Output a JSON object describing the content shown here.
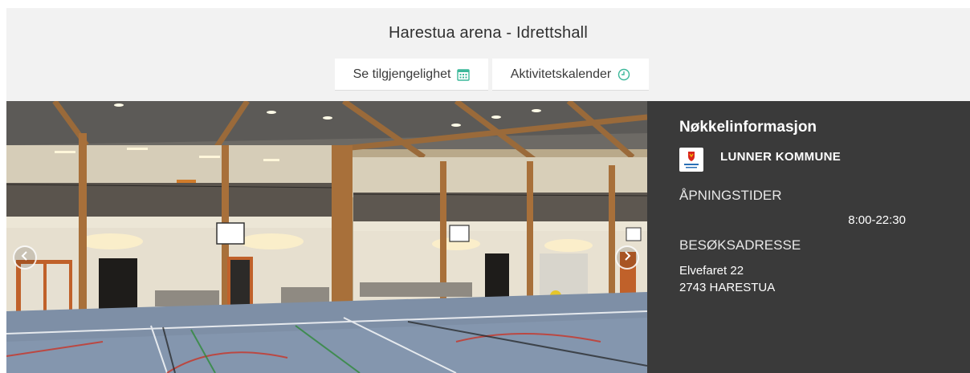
{
  "header": {
    "title": "Harestua arena - Idrettshall",
    "availability_button": "Se tilgjengelighet",
    "calendar_button": "Aktivitetskalender",
    "availability_icon": "calendar-grid-icon",
    "calendar_icon": "clock-icon",
    "accent_color": "#3cb89a"
  },
  "gallery": {
    "prev_icon": "chevron-left-icon",
    "next_icon": "chevron-right-icon"
  },
  "info": {
    "title": "Nøkkelinformasjon",
    "municipality": "LUNNER KOMMUNE",
    "opening_label": "ÅPNINGSTIDER",
    "opening_hours": "8:00-22:30",
    "address_label": "BESØKSADRESSE",
    "address_line1": "Elvefaret 22",
    "address_line2": "2743 HARESTUA",
    "panel_color": "#3a3a3a"
  }
}
